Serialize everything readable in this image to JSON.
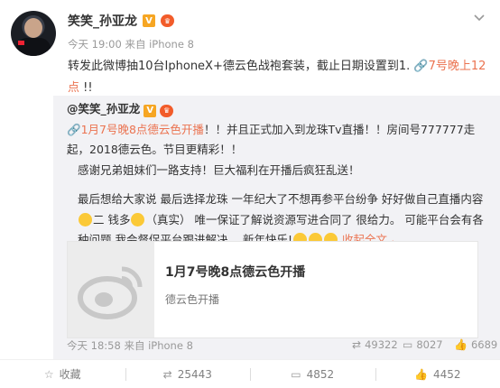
{
  "author": {
    "name": "笑笑_孙亚龙",
    "meta": "今天 19:00 来自 iPhone 8"
  },
  "post": {
    "text_a": "转发此微博抽10台IphoneX+德云色战袍套装，截止日期设置到1.",
    "link": "7号晚上12点",
    "text_b": "!!"
  },
  "repost": {
    "user": "@笑笑_孙亚龙",
    "link": "1月7号晚8点德云色开播",
    "line1_rest": "！！并且正式加入到龙珠Tv直播！！房间号777777走起，2018德云色。节目更精彩！！",
    "line2": "感谢兄弟姐妹们一路支持！巨大福利在开播后疯狂乱送！",
    "line3": "最后想给大家说 最后选择龙珠 一年纪大了不想再参平台纷争 好好做自己直播内容",
    "line3_b": "二 钱多",
    "line3_c": "（真实） 唯一保证了解说资源写进合同了 很给力。 可能平台会有各种问题 我会督促平台跟进解决。 新年快乐!",
    "fold": "收起全文",
    "card_title": "1月7号晚8点德云色开播",
    "card_sub": "德云色开播",
    "time": "今天 18:58 来自 iPhone 8",
    "reposts": "49322",
    "comments": "8027",
    "likes": "6689"
  },
  "actions": {
    "collect": "收藏",
    "repost": "25443",
    "comment": "4852",
    "like": "4452"
  }
}
